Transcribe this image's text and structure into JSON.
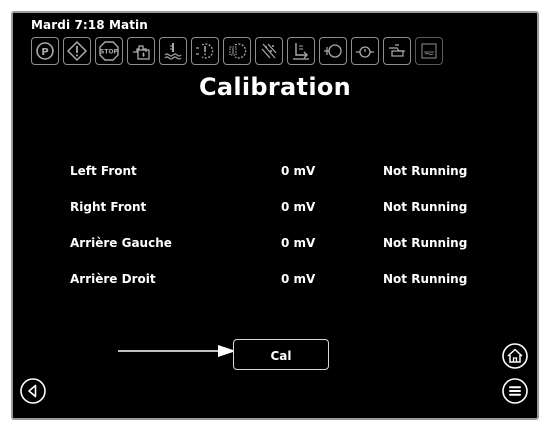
{
  "status": {
    "datetime": "Mardi 7:18 Matin"
  },
  "toolbar": {
    "icons": [
      "parking-brake-icon",
      "warning-icon",
      "stop-icon",
      "engine-coolant-icon",
      "coolant-temp-icon",
      "transmission-icon",
      "transmission-filter-icon",
      "particulate-filter-icon",
      "exhaust-fluid-icon",
      "engine-icon",
      "oil-pressure-icon",
      "fuel-icon",
      "fluid-level-icon"
    ]
  },
  "page": {
    "title": "Calibration"
  },
  "rows": [
    {
      "label": "Left Front",
      "value": "0 mV",
      "status": "Not Running"
    },
    {
      "label": "Right Front",
      "value": "0 mV",
      "status": "Not Running"
    },
    {
      "label": "Arrière Gauche",
      "value": "0 mV",
      "status": "Not Running"
    },
    {
      "label": "Arrière Droit",
      "value": "0 mV",
      "status": "Not Running"
    }
  ],
  "actions": {
    "cal_label": "Cal"
  },
  "nav": {
    "back_icon": "back-icon",
    "home_icon": "home-icon",
    "menu_icon": "menu-icon"
  },
  "colors": {
    "background": "#000000",
    "text": "#ffffff",
    "border": "#9a9a9a"
  }
}
